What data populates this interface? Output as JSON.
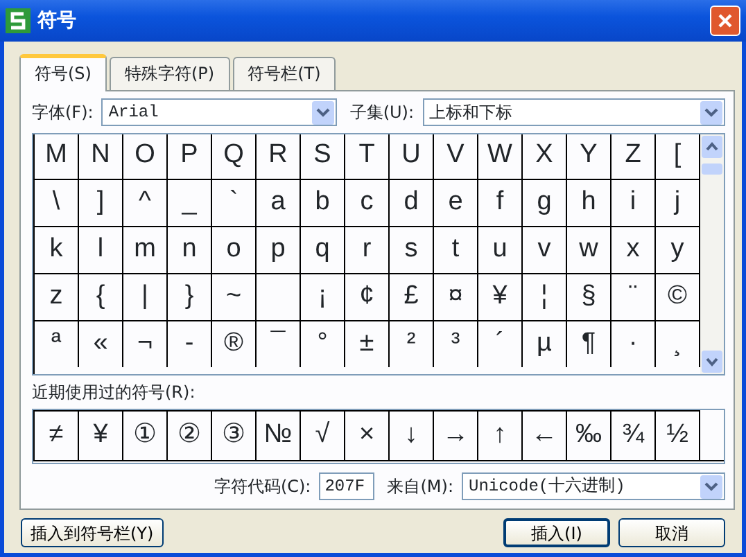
{
  "window": {
    "title": "符号"
  },
  "tabs": [
    {
      "label": "符号(S)",
      "selected": true
    },
    {
      "label": "特殊字符(P)",
      "selected": false
    },
    {
      "label": "符号栏(T)",
      "selected": false
    }
  ],
  "font": {
    "label": "字体(F):",
    "value": "Arial"
  },
  "subset": {
    "label": "子集(U):",
    "value": "上标和下标"
  },
  "symbols": [
    [
      "M",
      "N",
      "O",
      "P",
      "Q",
      "R",
      "S",
      "T",
      "U",
      "V",
      "W",
      "X",
      "Y",
      "Z",
      "["
    ],
    [
      "\\",
      "]",
      "^",
      "_",
      "`",
      "a",
      "b",
      "c",
      "d",
      "e",
      "f",
      "g",
      "h",
      "i",
      "j"
    ],
    [
      "k",
      "l",
      "m",
      "n",
      "o",
      "p",
      "q",
      "r",
      "s",
      "t",
      "u",
      "v",
      "w",
      "x",
      "y"
    ],
    [
      "z",
      "{",
      "|",
      "}",
      "~",
      {
        "kind": "empty"
      },
      "¡",
      "¢",
      "£",
      "¤",
      "¥",
      "¦",
      "§",
      "¨",
      "©"
    ],
    [
      "ª",
      "«",
      "¬",
      "-",
      "®",
      "¯",
      "°",
      "±",
      "²",
      "³",
      "´",
      "µ",
      "¶",
      "·",
      "¸"
    ]
  ],
  "recent": {
    "label": "近期使用过的符号(R):",
    "symbols": [
      "≠",
      "¥",
      "①",
      "②",
      "③",
      "№",
      "√",
      "×",
      "↓",
      "→",
      "↑",
      "←",
      "‰",
      "¾",
      "½"
    ]
  },
  "char_code": {
    "label": "字符代码(C):",
    "value": "207F"
  },
  "from": {
    "label": "来自(M):",
    "value": "Unicode(十六进制)"
  },
  "buttons": {
    "insert_to_bar": "插入到符号栏(Y)",
    "insert": "插入(I)",
    "cancel": "取消"
  }
}
